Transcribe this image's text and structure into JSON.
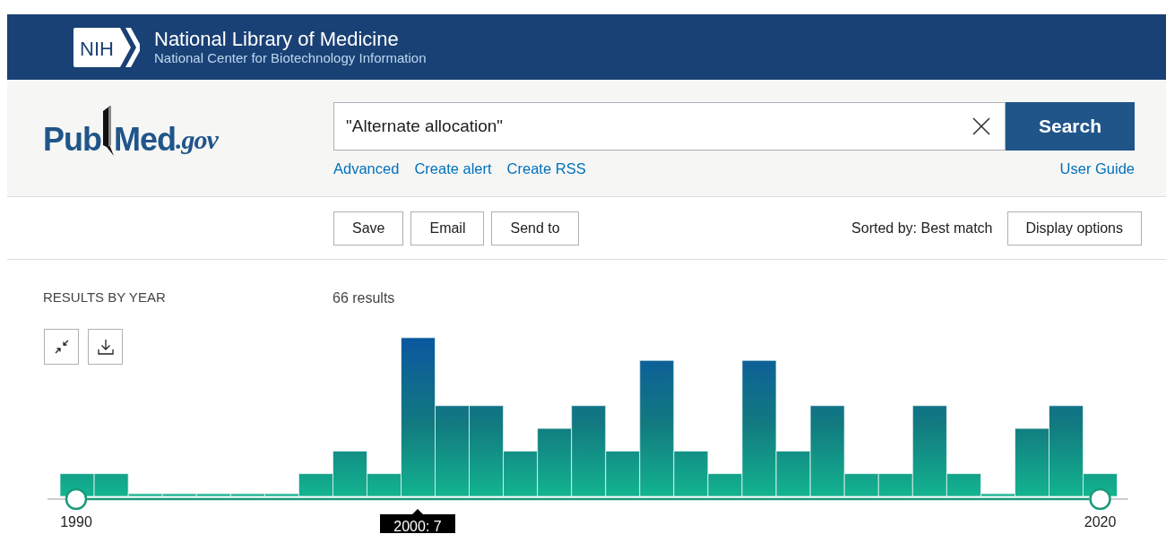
{
  "header": {
    "title": "National Library of Medicine",
    "subtitle": "National Center for Biotechnology Information"
  },
  "nih": "NIH",
  "logo": {
    "parts": [
      "Pub",
      "Med"
    ],
    "domain": ".gov"
  },
  "search": {
    "value": "\"Alternate allocation\"",
    "button": "Search",
    "links": [
      "Advanced",
      "Create alert",
      "Create RSS"
    ],
    "help_link": "User Guide"
  },
  "toolbar": {
    "actions": [
      "Save",
      "Email",
      "Send to"
    ],
    "sort": "Sorted by: Best match",
    "display_button": "Display options"
  },
  "results": {
    "heading": "RESULTS BY YEAR",
    "count": "66 results",
    "axis_labels": [
      "1990",
      "2020"
    ],
    "tooltip": "2000: 7"
  }
}
